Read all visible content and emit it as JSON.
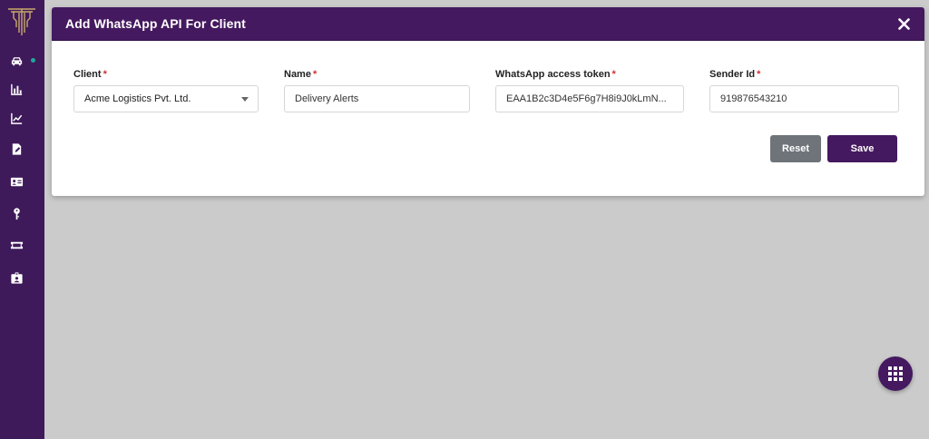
{
  "modal": {
    "title": "Add WhatsApp API For Client",
    "close_icon": "close-icon"
  },
  "form": {
    "client": {
      "label": "Client",
      "required_mark": "*",
      "value": "Acme Logistics Pvt. Ltd."
    },
    "name": {
      "label": "Name",
      "required_mark": "*",
      "value": "Delivery Alerts"
    },
    "token": {
      "label": "WhatsApp access token",
      "required_mark": "*",
      "value": "EAA1B2c3D4e5F6g7H8i9J0kLmN..."
    },
    "sender": {
      "label": "Sender Id",
      "required_mark": "*",
      "value": "919876543210"
    }
  },
  "buttons": {
    "reset": "Reset",
    "save": "Save"
  },
  "sidebar": {
    "items": [
      {
        "icon": "car-icon"
      },
      {
        "icon": "bar-chart-icon"
      },
      {
        "icon": "line-chart-icon"
      },
      {
        "icon": "document-edit-icon"
      },
      {
        "icon": "id-card-icon"
      },
      {
        "icon": "key-icon"
      },
      {
        "icon": "ticket-icon"
      },
      {
        "icon": "badge-icon"
      }
    ]
  },
  "colors": {
    "brand": "#45195f",
    "sidebar": "#3f1a5a",
    "required": "#d32f2f",
    "active_dot": "#1fa89a",
    "reset": "#6e7479"
  }
}
